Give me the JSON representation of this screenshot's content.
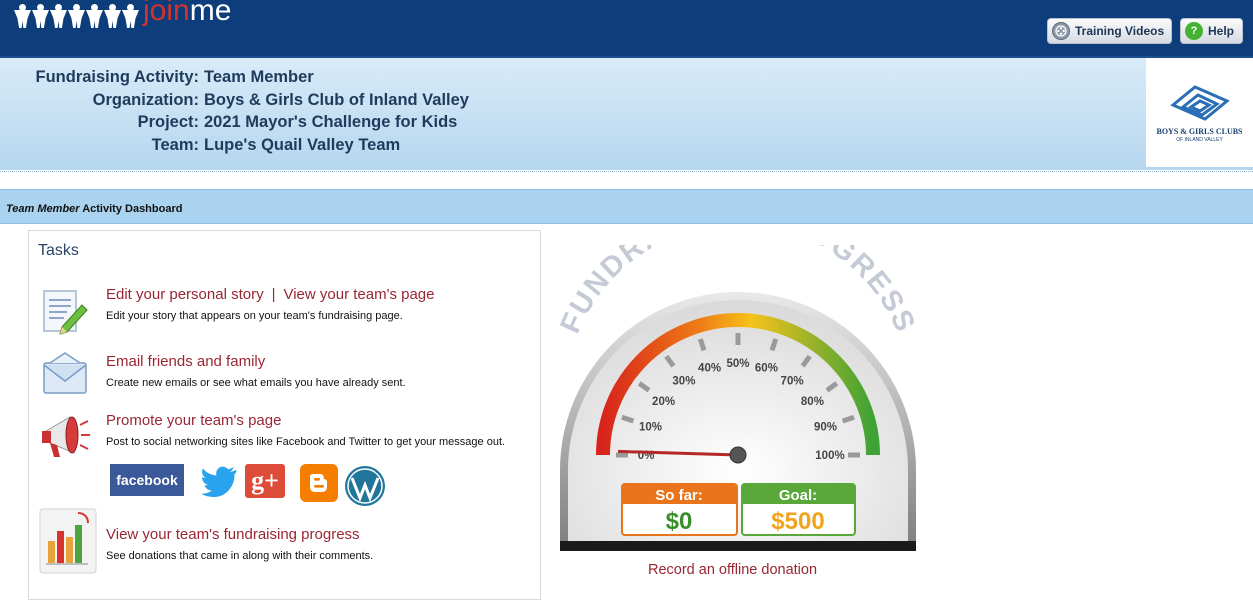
{
  "header": {
    "logo": {
      "join": "join",
      "me": "me"
    },
    "buttons": {
      "training_videos": "Training Videos",
      "help": "Help"
    },
    "icons": {
      "training_videos": "film-reel-icon",
      "help": "question-icon"
    }
  },
  "info": [
    {
      "label": "Fundraising Activity:",
      "value": "Team Member"
    },
    {
      "label": "Organization:",
      "value": "Boys & Girls Club of Inland Valley"
    },
    {
      "label": "Project:",
      "value": "2021 Mayor's Challenge for Kids"
    },
    {
      "label": "Team:",
      "value": "Lupe's Quail Valley Team"
    }
  ],
  "org_logo": {
    "line1": "BOYS & GIRLS CLUBS",
    "line2": "OF INLAND VALLEY"
  },
  "dashboard": {
    "italic": "Team Member",
    "rest": " Activity Dashboard"
  },
  "tasks": {
    "title": "Tasks",
    "items": [
      {
        "link": "Edit your personal story",
        "separator": "|",
        "link2": "View your team's page",
        "desc": "Edit your story that appears on your team's fundraising page.",
        "icon": "document-pencil-icon"
      },
      {
        "link": "Email friends and family",
        "desc": "Create new emails or see what emails you have already sent.",
        "icon": "envelope-icon"
      },
      {
        "link": "Promote your team's page",
        "desc": "Post to social networking sites like Facebook and Twitter to get your message out.",
        "icon": "megaphone-icon"
      },
      {
        "link": "View your team's fundraising progress",
        "desc": "See donations that came in along with their comments.",
        "icon": "bar-chart-icon"
      }
    ],
    "social": {
      "facebook": "facebook",
      "google_plus": "g+"
    }
  },
  "gauge": {
    "title": "FUNDRAISING PROGRESS",
    "progress_percent": 0,
    "ticks": [
      "0%",
      "10%",
      "20%",
      "30%",
      "40%",
      "50%",
      "60%",
      "70%",
      "80%",
      "90%",
      "100%"
    ],
    "so_far_label": "So far:",
    "so_far_value": "$0",
    "goal_label": "Goal:",
    "goal_value": "$500",
    "colors": {
      "so_far": "#e8741c",
      "goal": "#5aa83a",
      "so_far_value": "#3a8f2a",
      "goal_value": "#f2a31b"
    }
  },
  "record_offline": "Record an offline donation"
}
